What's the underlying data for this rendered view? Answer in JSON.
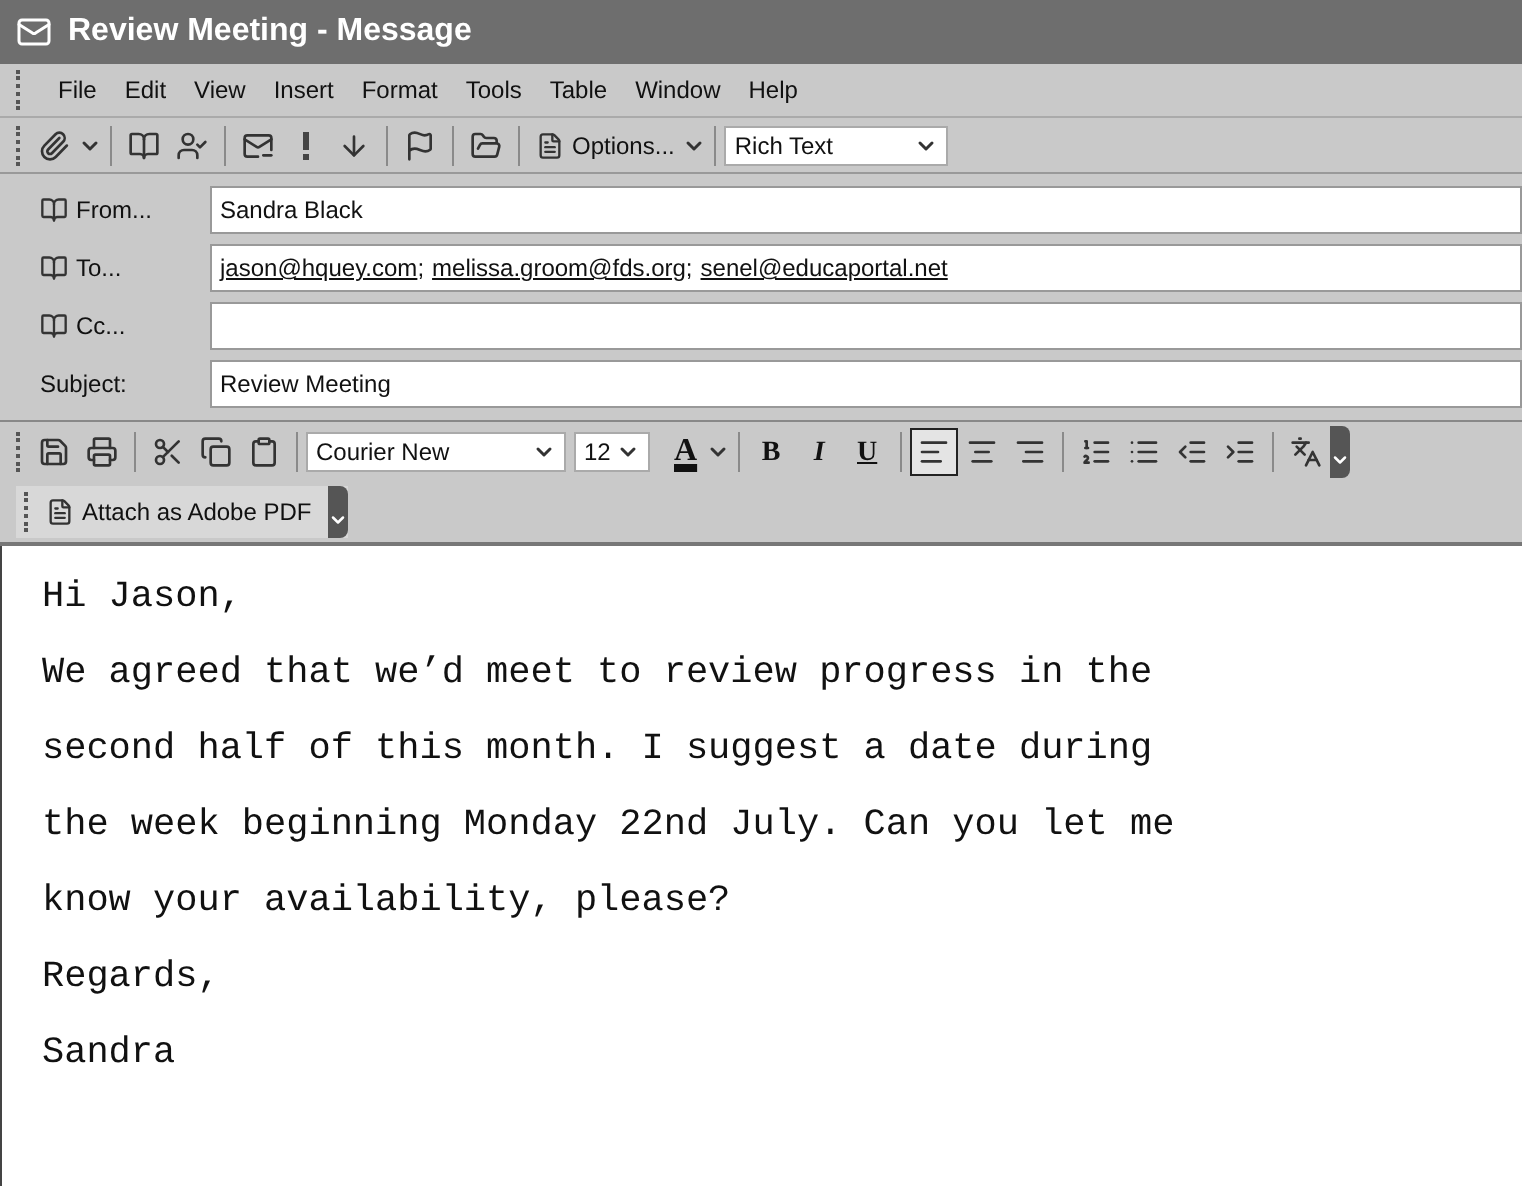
{
  "window": {
    "title": "Review Meeting - Message"
  },
  "menu": [
    "File",
    "Edit",
    "View",
    "Insert",
    "Format",
    "Tools",
    "Table",
    "Window",
    "Help"
  ],
  "toolbar": {
    "options_button": "Options...",
    "format_select": "Rich Text"
  },
  "header": {
    "fields": [
      {
        "kind": "button",
        "label": "From...",
        "value": "Sandra Black"
      },
      {
        "kind": "button",
        "label": "To...",
        "recipients": [
          "jason@hquey.com",
          "melissa.groom@fds.org",
          "senel@educaportal.net"
        ],
        "separator": ";"
      },
      {
        "kind": "button",
        "label": "Cc..."
      },
      {
        "kind": "plain",
        "label": "Subject:",
        "value": "Review Meeting"
      }
    ]
  },
  "format_toolbar": {
    "font": "Courier New",
    "size": "12",
    "font_color": "A",
    "styles": [
      {
        "kind": "bold",
        "label": "B"
      },
      {
        "kind": "italic",
        "label": "I"
      },
      {
        "kind": "underline",
        "label": "U"
      }
    ],
    "alignments": [
      {
        "kind": "left",
        "selected": true
      },
      {
        "kind": "center",
        "selected": false
      },
      {
        "kind": "right",
        "selected": false
      }
    ]
  },
  "pdf_toolbar": {
    "button": "Attach as Adobe PDF"
  },
  "body": {
    "paragraphs": [
      "Hi Jason,",
      "We agreed that we’d meet to review progress in the",
      "second half of this month. I suggest a date during",
      "the week beginning Monday 22nd July. Can you let me",
      "know your availability, please?",
      "Regards,",
      "Sandra"
    ]
  }
}
